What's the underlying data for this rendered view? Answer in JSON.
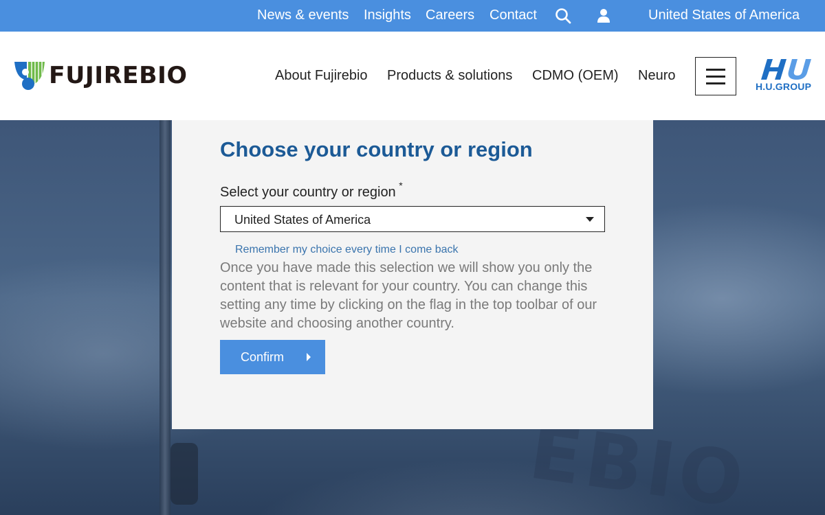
{
  "topbar": {
    "links": [
      "News & events",
      "Insights",
      "Careers",
      "Contact"
    ],
    "search_icon": "search-icon",
    "user_icon": "user-icon",
    "region": "United States of America"
  },
  "header": {
    "logo_text": "FUJIREBIO",
    "nav": [
      "About Fujirebio",
      "Products & solutions",
      "CDMO (OEM)",
      "Neuro"
    ],
    "menu_icon": "hamburger-menu-icon",
    "group_logo_mark": "HU",
    "group_logo_text": "H.U.GROUP"
  },
  "hero": {
    "background_text": "EBIO"
  },
  "modal": {
    "title": "Choose your country or region",
    "select_label": "Select your country or region",
    "required_mark": "*",
    "selected_country": "United States of America",
    "remember_text": "Remember my choice every time I come back",
    "description": "Once you have made this selection we will show you only the content that is relevant for your country. You can change this setting any time by clicking on the flag in the top toolbar of our website and choosing another country.",
    "confirm_label": "Confirm"
  },
  "colors": {
    "accent": "#4a8fdf",
    "title_blue": "#1c5a96",
    "link_blue": "#3a74ad",
    "text_gray": "#7a7a7a"
  }
}
